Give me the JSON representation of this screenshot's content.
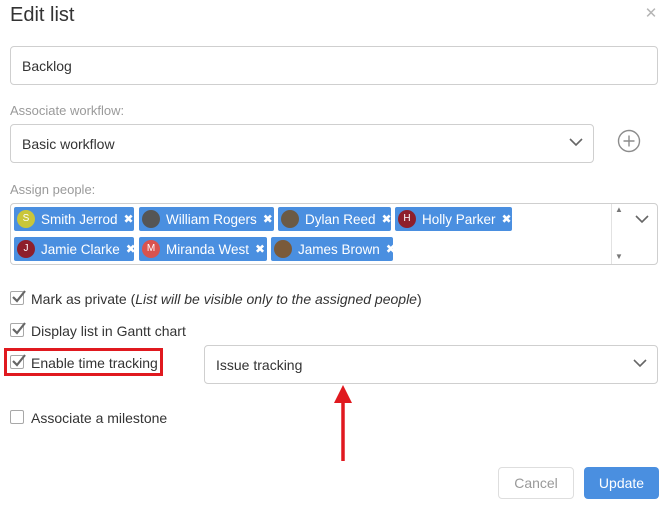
{
  "dialog": {
    "title": "Edit list",
    "close_icon": "close-icon"
  },
  "list_name": {
    "value": "Backlog"
  },
  "workflow": {
    "label": "Associate workflow:",
    "value": "Basic workflow",
    "add_icon": "plus-circle-icon"
  },
  "people": {
    "label": "Assign people:",
    "tags": [
      {
        "name": "Smith Jerrod",
        "initial": "S",
        "color": "#c9c63a"
      },
      {
        "name": "William Rogers",
        "initial": "",
        "color": "#555555"
      },
      {
        "name": "Dylan Reed",
        "initial": "",
        "color": "#6b5a45"
      },
      {
        "name": "Holly Parker",
        "initial": "H",
        "color": "#8e1f2b"
      },
      {
        "name": "Jamie Clarke",
        "initial": "J",
        "color": "#8e1f2b"
      },
      {
        "name": "Miranda West",
        "initial": "M",
        "color": "#d9534f"
      },
      {
        "name": "James Brown",
        "initial": "",
        "color": "#7a5a3a"
      }
    ]
  },
  "options": {
    "private_label": "Mark as private (",
    "private_note": "List will be visible only to the assigned people",
    "private_close": ")",
    "gantt_label": "Display list in Gantt chart",
    "time_tracking_label": "Enable time tracking",
    "tracking_select": "Issue tracking",
    "milestone_label": "Associate a milestone"
  },
  "state": {
    "private_checked": true,
    "gantt_checked": true,
    "time_tracking_checked": true,
    "milestone_checked": false
  },
  "actions": {
    "cancel": "Cancel",
    "update": "Update"
  },
  "colors": {
    "accent": "#4a8fe0",
    "highlight": "#e0191f"
  }
}
